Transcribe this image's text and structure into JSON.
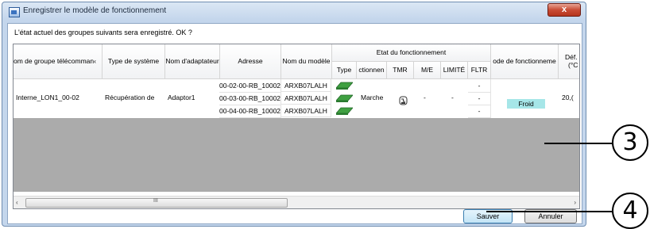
{
  "window": {
    "title": "Enregistrer le modèle de fonctionnement",
    "close_label": "x"
  },
  "prompt": "L'état actuel des groupes suivants sera enregistré. OK ?",
  "columns": {
    "group_name": "om de groupe télécomman‹",
    "system_type": "Type de système",
    "adapter_name": "Nom d'adaptateur",
    "address": "Adresse",
    "model_name": "Nom du modèle",
    "state_group": "Etat du fonctionnement",
    "type": "Type",
    "operation": "ctionnen",
    "tmr": "TMR",
    "me": "M/E",
    "limit": "LIMITÉ",
    "fltr": "FLTR",
    "mode": "ode de fonctionneme",
    "setpoint_line1": "Déf. te",
    "setpoint_line2": "(°C"
  },
  "row": {
    "group_name": "Interne_LON1_00-02",
    "system_type": "Récupération de",
    "adapter_name": "Adaptor1",
    "addresses": [
      "00-02-00-RB_10002",
      "00-03-00-RB_10002",
      "00-04-00-RB_10002"
    ],
    "models": [
      "ARXB07LALH",
      "ARXB07LALH",
      "ARXB07LALH"
    ],
    "operation": "Marche",
    "timer_icon": "timer-icon",
    "me": "-",
    "limit": "-",
    "fltr": [
      "-",
      "-",
      "-"
    ],
    "mode": "Froid",
    "setpoint": "20,("
  },
  "scroll": {
    "left_arrow": "‹",
    "right_arrow": "›",
    "grip": "III"
  },
  "buttons": {
    "save": "Sauver",
    "cancel": "Annuler"
  },
  "callouts": {
    "three": "3",
    "four": "4"
  },
  "colors": {
    "froid_bg": "#a6e6e8",
    "unit_icon": "#3fa041",
    "grid_empty": "#ababab"
  }
}
